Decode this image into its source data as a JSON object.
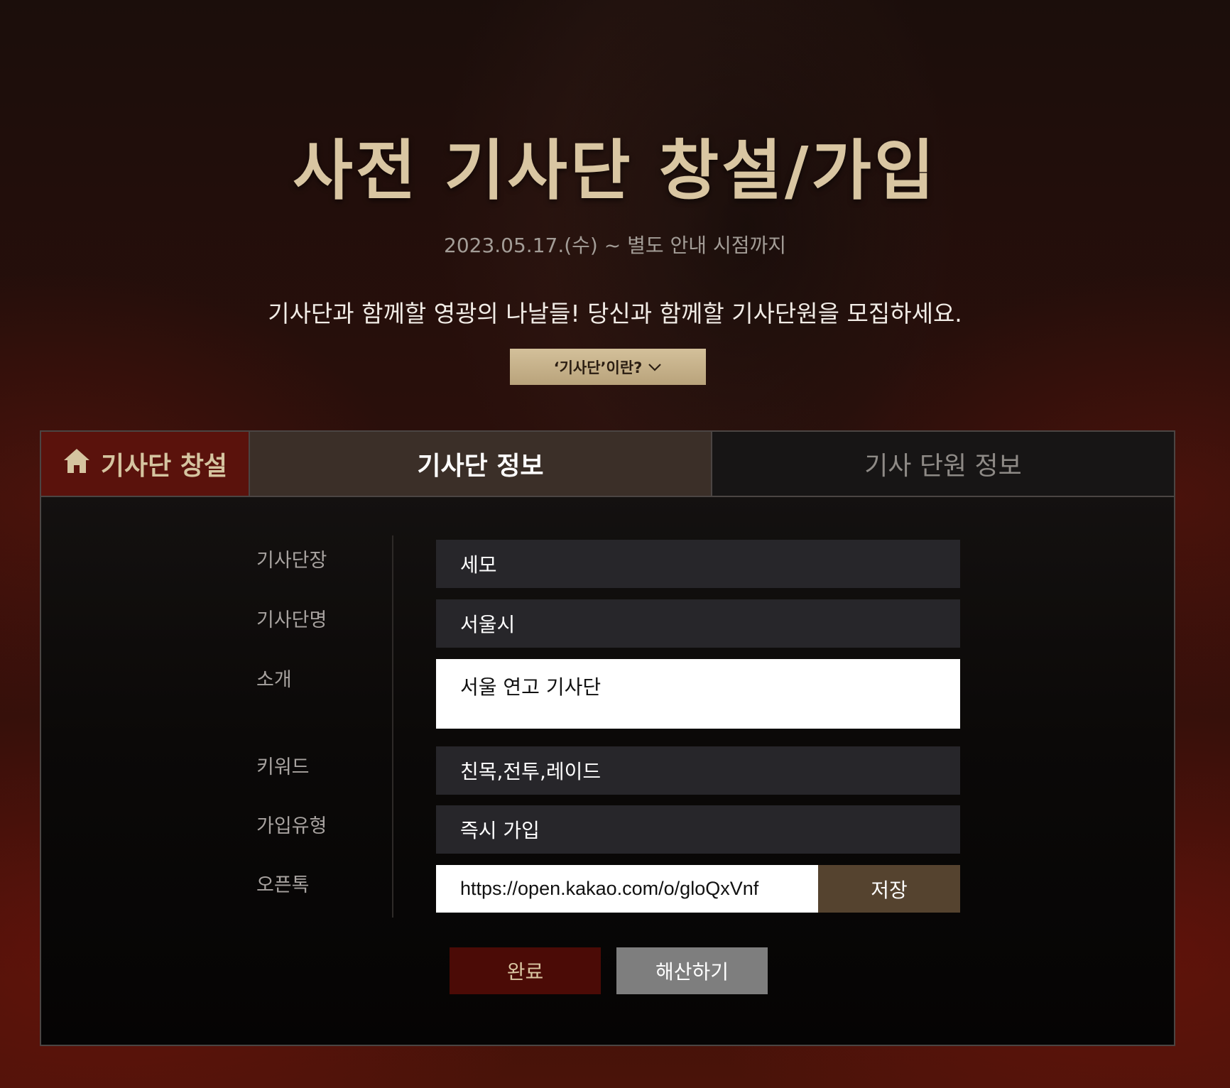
{
  "hero": {
    "title": "사전 기사단 창설/가입",
    "period": "2023.05.17.(수) ~ 별도 안내 시점까지",
    "description": "기사단과 함께할 영광의 나날들! 당신과 함께할 기사단원을 모집하세요.",
    "what_button_label": "‘기사단’이란?",
    "what_button_icon": "chevron-down-icon"
  },
  "tabs": {
    "home": {
      "label": "기사단 창설",
      "icon": "home-icon"
    },
    "info": {
      "label": "기사단 정보"
    },
    "members": {
      "label": "기사 단원 정보"
    }
  },
  "form": {
    "leader": {
      "label": "기사단장",
      "value": "세모"
    },
    "name": {
      "label": "기사단명",
      "value": "서울시"
    },
    "intro": {
      "label": "소개",
      "value": "서울 연고 기사단"
    },
    "keywords": {
      "label": "키워드",
      "value": "친목,전투,레이드"
    },
    "join_type": {
      "label": "가입유형",
      "value": "즉시 가입"
    },
    "open_chat": {
      "label": "오픈톡",
      "value": "https://open.kakao.com/o/gloQxVnf",
      "save_label": "저장"
    }
  },
  "actions": {
    "complete_label": "완료",
    "disband_label": "해산하기"
  },
  "colors": {
    "gold": "#d9c6a2",
    "crimson": "#5a120c",
    "brown_tab": "#3b2f28",
    "save_button": "#55432f",
    "disband_button": "#7e7e7e"
  }
}
